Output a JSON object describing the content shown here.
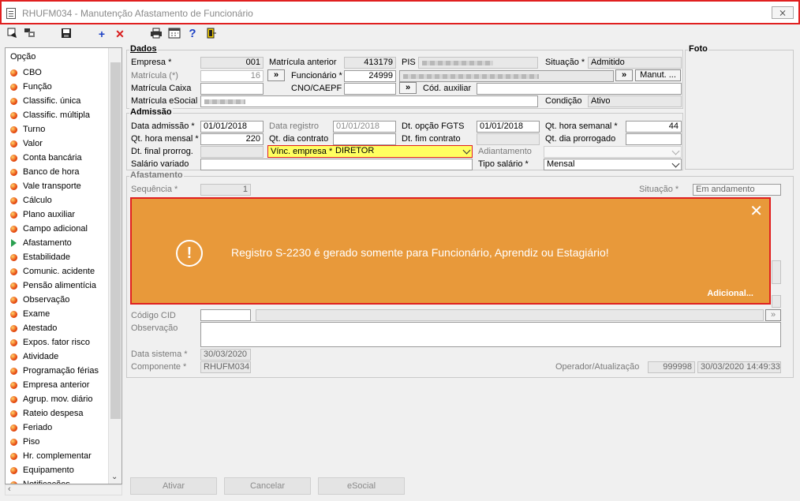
{
  "window": {
    "title": "RHUFM034 - Manutenção Afastamento de Funcionário",
    "close_label": "⨯"
  },
  "toolbar": {
    "icons": [
      "first-record-icon",
      "browse-icon",
      "save-icon",
      "add-icon",
      "delete-icon",
      "print-icon",
      "calendar-icon",
      "help-icon",
      "exit-icon"
    ]
  },
  "sidebar": {
    "header": "Opção",
    "items": [
      "CBO",
      "Função",
      "Classific. única",
      "Classific. múltipla",
      "Turno",
      "Valor",
      "Conta bancária",
      "Banco de hora",
      "Vale transporte",
      "Cálculo",
      "Plano auxiliar",
      "Campo adicional",
      "Afastamento",
      "Estabilidade",
      "Comunic. acidente",
      "Pensão alimentícia",
      "Observação",
      "Exame",
      "Atestado",
      "Expos. fator risco",
      "Atividade",
      "Programação férias",
      "Empresa anterior",
      "Agrup. mov. diário",
      "Rateio despesa",
      "Feriado",
      "Piso",
      "Hr. complementar",
      "Equipamento",
      "Notificações"
    ],
    "active_index": 12
  },
  "dados": {
    "title": "Dados",
    "empresa_label": "Empresa *",
    "empresa_value": "001",
    "matricula_anterior_label": "Matrícula anterior",
    "matricula_anterior_value": "413179",
    "pis_label": "PIS",
    "situacao_label": "Situação *",
    "situacao_value": "Admitido",
    "matricula_label": "Matrícula (*)",
    "matricula_value": "16",
    "goto_label": "»",
    "funcionario_label": "Funcionário *",
    "funcionario_value": "24999",
    "manut_label": "Manut. ...",
    "matricula_caixa_label": "Matrícula Caixa",
    "cno_label": "CNO/CAEPF",
    "cod_auxiliar_label": "Cód. auxiliar",
    "matricula_esocial_label": "Matrícula eSocial",
    "condicao_label": "Condição",
    "condicao_value": "Ativo"
  },
  "foto": {
    "title": "Foto"
  },
  "admissao": {
    "title": "Admissão",
    "data_admissao_label": "Data admissão *",
    "data_admissao_value": "01/01/2018",
    "data_registro_label": "Data registro",
    "data_registro_value": "01/01/2018",
    "dt_opcao_fgts_label": "Dt. opção FGTS",
    "dt_opcao_fgts_value": "01/01/2018",
    "qt_hora_semanal_label": "Qt. hora semanal *",
    "qt_hora_semanal_value": "44",
    "qt_hora_mensal_label": "Qt. hora mensal *",
    "qt_hora_mensal_value": "220",
    "qt_dia_contrato_label": "Qt. dia contrato",
    "dt_fim_contrato_label": "Dt. fim contrato",
    "qt_dia_prorrogado_label": "Qt. dia prorrogado",
    "dt_final_prorrog_label": "Dt. final prorrog.",
    "vinc_empresa_label": "Vínc. empresa *",
    "vinc_empresa_value": "DIRETOR",
    "adiantamento_label": "Adiantamento",
    "salario_variado_label": "Salário variado",
    "tipo_salario_label": "Tipo salário *",
    "tipo_salario_value": "Mensal"
  },
  "afastamento": {
    "title": "Afastamento",
    "sequencia_label": "Sequência *",
    "sequencia_value": "1",
    "situacao_label": "Situação *",
    "situacao_value": "Em andamento",
    "codigo_cid_label": "Código CID",
    "observacao_label": "Observação",
    "data_sistema_label": "Data sistema *",
    "data_sistema_value": "30/03/2020",
    "componente_label": "Componente *",
    "componente_value": "RHUFM034",
    "operador_label": "Operador/Atualização",
    "operador_value": "999998",
    "atualizacao_value": "30/03/2020 14:49:33"
  },
  "toast": {
    "message": "Registro S-2230 é gerado somente para Funcionário, Aprendiz ou Estagiário!",
    "more_label": "Adicional...",
    "close_label": "✕",
    "icon_label": "!",
    "color": "#e8993a"
  },
  "buttons": {
    "ativar": "Ativar",
    "cancelar": "Cancelar",
    "esocial": "eSocial"
  }
}
